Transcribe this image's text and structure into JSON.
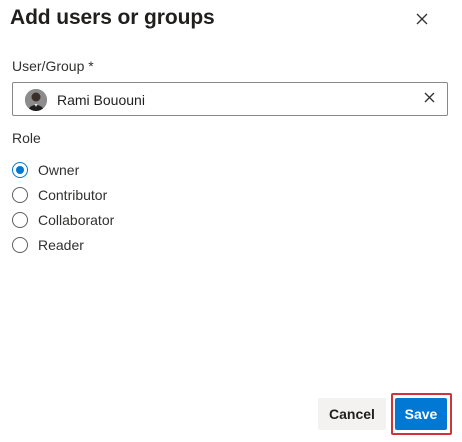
{
  "dialog": {
    "title": "Add users or groups",
    "close_icon": "close-icon"
  },
  "user_field": {
    "label": "User/Group *",
    "selected_user": "Rami Bououni",
    "avatar_icon": "user-avatar",
    "clear_icon": "clear-icon"
  },
  "role": {
    "label": "Role",
    "options": [
      {
        "label": "Owner",
        "checked": true
      },
      {
        "label": "Contributor",
        "checked": false
      },
      {
        "label": "Collaborator",
        "checked": false
      },
      {
        "label": "Reader",
        "checked": false
      }
    ]
  },
  "footer": {
    "cancel_label": "Cancel",
    "save_label": "Save"
  },
  "colors": {
    "accent": "#0078d4",
    "highlight": "#d13438"
  }
}
